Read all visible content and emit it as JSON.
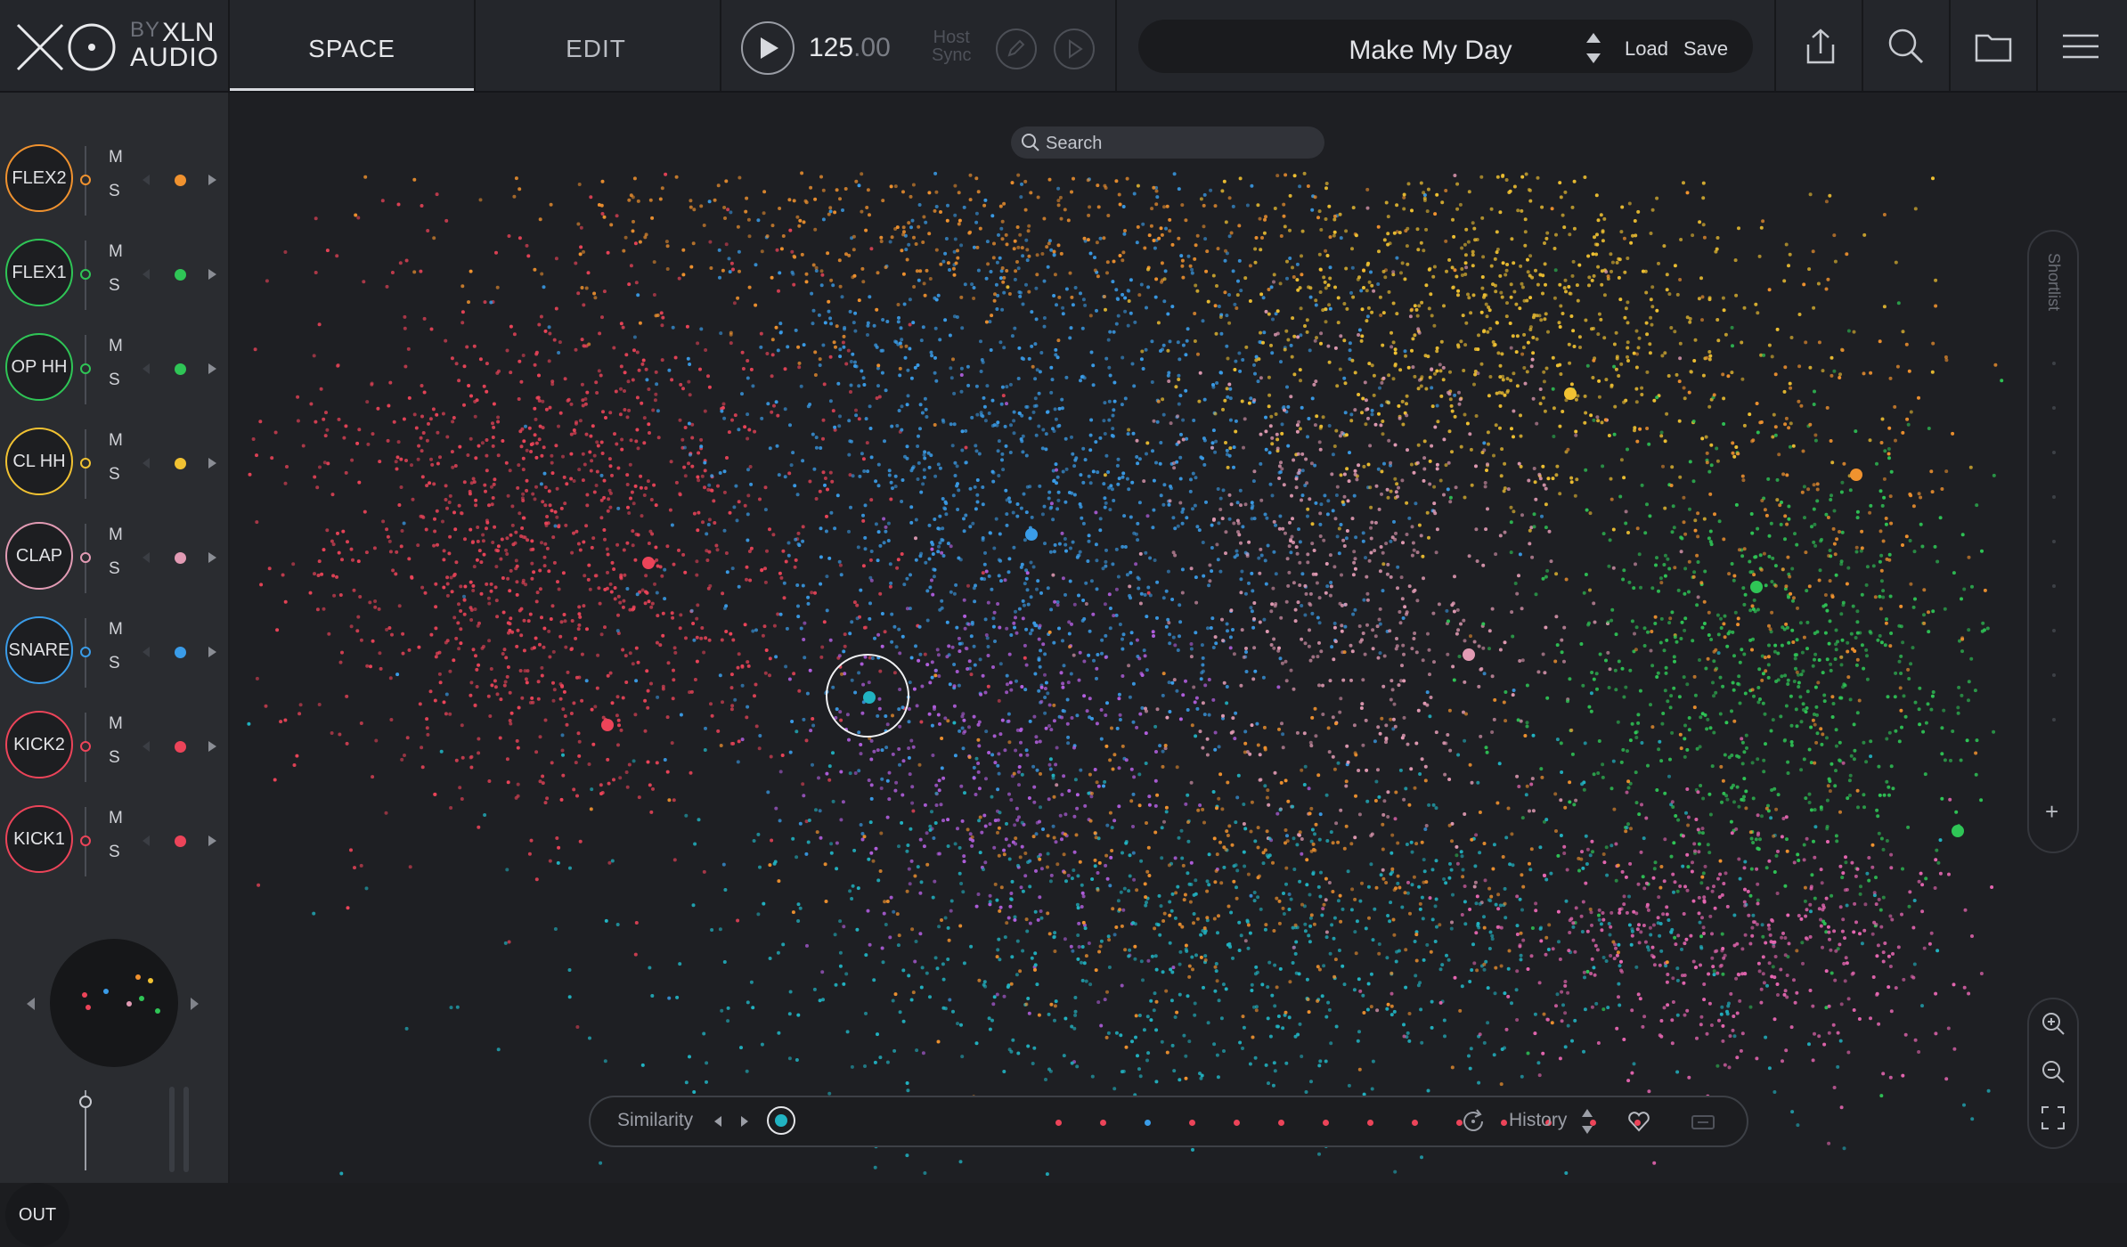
{
  "header": {
    "logo_by": "BY",
    "logo_xln": "XLN",
    "logo_audio": "AUDIO",
    "tabs": [
      {
        "label": "SPACE"
      },
      {
        "label": "EDIT"
      }
    ],
    "bpm_int": "125",
    "bpm_dec": ".00",
    "host_sync_line1": "Host",
    "host_sync_line2": "Sync",
    "preset_name": "Make My Day",
    "load_label": "Load",
    "save_label": "Save"
  },
  "tracks": [
    {
      "name": "FLEX2",
      "color": "#f0922f",
      "m": "M",
      "s": "S"
    },
    {
      "name": "FLEX1",
      "color": "#2fc556",
      "m": "M",
      "s": "S"
    },
    {
      "name": "OP HH",
      "color": "#2fc556",
      "m": "M",
      "s": "S"
    },
    {
      "name": "CL HH",
      "color": "#f1c232",
      "m": "M",
      "s": "S"
    },
    {
      "name": "CLAP",
      "color": "#e29bb4",
      "m": "M",
      "s": "S"
    },
    {
      "name": "SNARE",
      "color": "#3a9ce8",
      "m": "M",
      "s": "S"
    },
    {
      "name": "KICK2",
      "color": "#ec4459",
      "m": "M",
      "s": "S"
    },
    {
      "name": "KICK1",
      "color": "#ec4459",
      "m": "M",
      "s": "S"
    }
  ],
  "output": {
    "label": "OUT"
  },
  "space": {
    "search_placeholder": "Search",
    "shortlist_label": "Shortlist",
    "similarity_label": "Similarity",
    "history_label": "History",
    "similarity_dots": [
      "#ec4459",
      "#ec4459",
      "#3a9ce8",
      "#ec4459",
      "#ec4459",
      "#ec4459",
      "#ec4459",
      "#ec4459",
      "#ec4459",
      "#ec4459",
      "#ec4459",
      "#ec4459",
      "#ec4459",
      "#ec4459"
    ]
  },
  "colors": {
    "kick": "#ec4459",
    "snare": "#3a9ce8",
    "clap": "#e29bb4",
    "closed_hat": "#f1c232",
    "open_hat": "#2fc556",
    "perc": "#f0922f",
    "purple": "#b35fe0",
    "teal": "#21b3c2",
    "pink": "#e867b3",
    "selection": "#21b3c2"
  }
}
